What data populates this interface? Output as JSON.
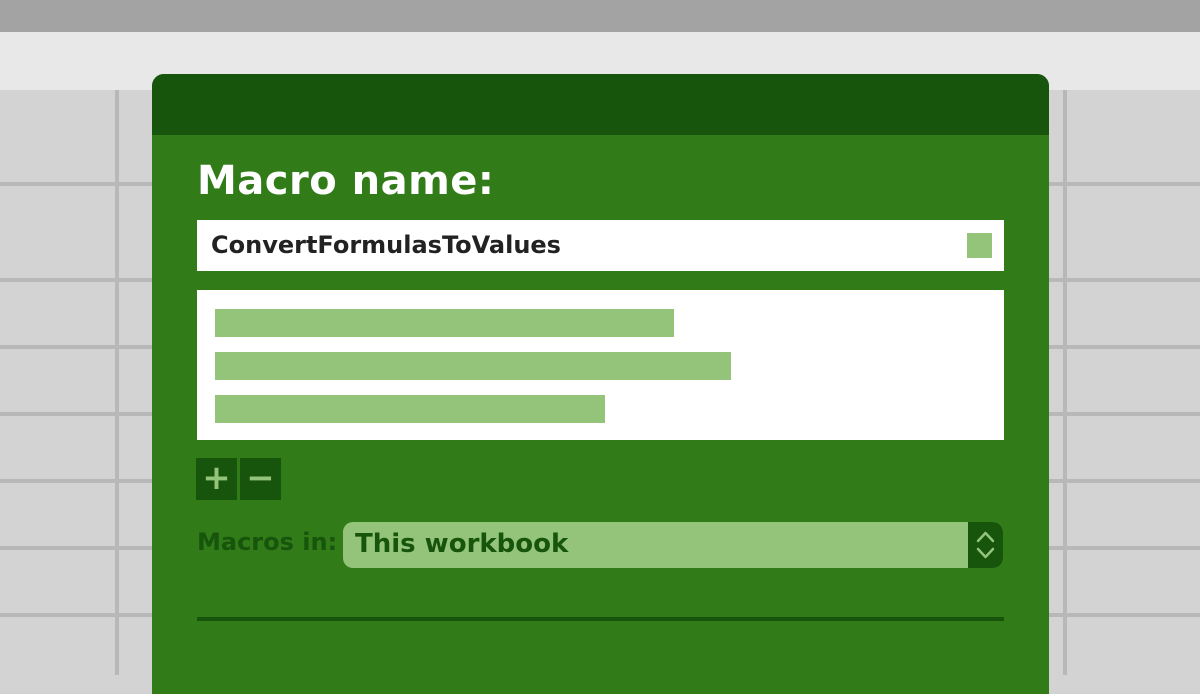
{
  "dialog": {
    "macro_name_label": "Macro name:",
    "macro_name_value": "ConvertFormulasToValues",
    "add_symbol": "+",
    "remove_symbol": "−",
    "macros_in_label": "Macros in:",
    "macros_in_value": "This workbook"
  },
  "colors": {
    "dialog_body": "#317c19",
    "dialog_header": "#17540c",
    "light_green": "#93c47a",
    "sheet_gray": "#d3d3d3"
  },
  "icons": {
    "select_arrows": "up-down-chevron-icon"
  }
}
